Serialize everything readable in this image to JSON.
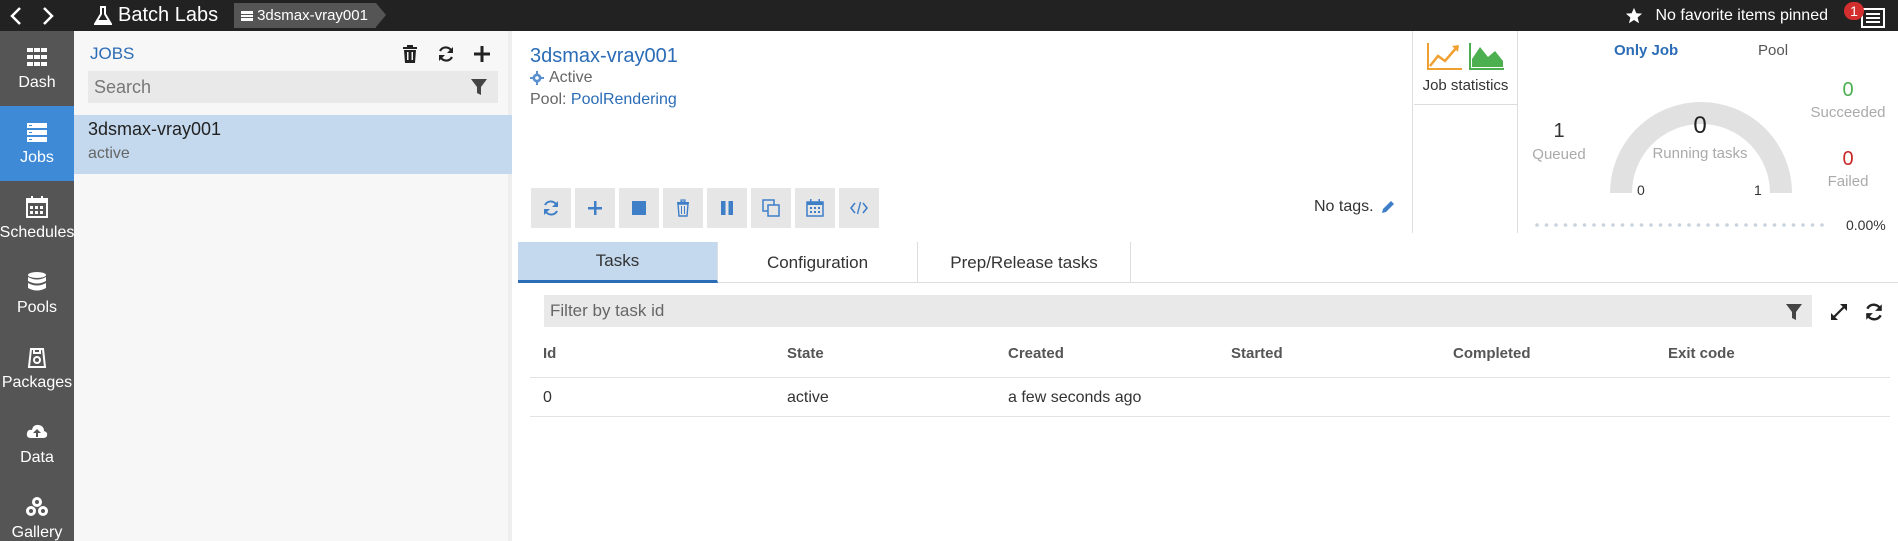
{
  "topbar": {
    "brand": "Batch Labs",
    "breadcrumb": "3dsmax-vray001",
    "favorites": "No favorite items pinned",
    "notification_count": "1"
  },
  "sidebar": {
    "items": [
      {
        "label": "Dash",
        "icon": "dashboard-icon"
      },
      {
        "label": "Jobs",
        "icon": "jobs-icon"
      },
      {
        "label": "Schedules",
        "icon": "calendar-icon"
      },
      {
        "label": "Pools",
        "icon": "database-icon"
      },
      {
        "label": "Packages",
        "icon": "package-icon"
      },
      {
        "label": "Data",
        "icon": "cloud-upload-icon"
      },
      {
        "label": "Gallery",
        "icon": "gallery-icon"
      }
    ],
    "active": "Jobs"
  },
  "jobs_panel": {
    "title": "JOBS",
    "search_placeholder": "Search",
    "items": [
      {
        "name": "3dsmax-vray001",
        "state": "active"
      }
    ]
  },
  "job": {
    "title": "3dsmax-vray001",
    "status": "Active",
    "pool_label": "Pool:",
    "pool_name": "PoolRendering",
    "tags": "No tags."
  },
  "job_statistics": {
    "label": "Job statistics"
  },
  "gauge": {
    "tabs": [
      "Only Job",
      "Pool"
    ],
    "selected_tab": "Only Job",
    "queued": {
      "value": "1",
      "label": "Queued"
    },
    "running": {
      "value": "0",
      "label": "Running tasks"
    },
    "succeeded": {
      "value": "0",
      "label": "Succeeded"
    },
    "failed": {
      "value": "0",
      "label": "Failed"
    },
    "min": "0",
    "max": "1",
    "progress": "0.00%",
    "colors": {
      "succeeded": "#4caf50",
      "failed": "#c62828"
    }
  },
  "tabs": [
    {
      "label": "Tasks",
      "active": true
    },
    {
      "label": "Configuration",
      "active": false
    },
    {
      "label": "Prep/Release tasks",
      "active": false
    }
  ],
  "tasks": {
    "filter_placeholder": "Filter by task id",
    "columns": [
      "Id",
      "State",
      "Created",
      "Started",
      "Completed",
      "Exit code"
    ],
    "rows": [
      [
        "0",
        "active",
        "a few seconds ago",
        "",
        "",
        ""
      ]
    ]
  },
  "colors": {
    "accent": "#2b6cb6",
    "sidebar": "#555555",
    "sidebar_active": "#3f8ad6",
    "selection": "#c4d9ee"
  }
}
